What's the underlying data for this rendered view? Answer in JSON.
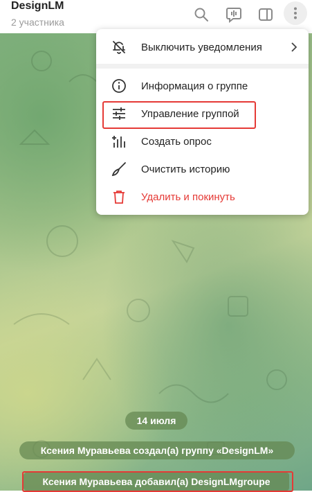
{
  "header": {
    "title": "DesignLM",
    "subtitle": "2 участника",
    "icons": [
      "search-icon",
      "voice-chat-icon",
      "sidebar-toggle-icon",
      "more-vertical-icon"
    ]
  },
  "menu": {
    "items": [
      {
        "label": "Выключить уведомления",
        "icon": "mute-bell-icon"
      },
      {
        "label": "Информация о группе",
        "icon": "info-icon"
      },
      {
        "label": "Управление группой",
        "icon": "sliders-icon"
      },
      {
        "label": "Создать опрос",
        "icon": "poll-icon"
      },
      {
        "label": "Очистить историю",
        "icon": "broom-icon"
      },
      {
        "label": "Удалить и покинуть",
        "icon": "trash-icon"
      }
    ],
    "danger_color": "#e53935"
  },
  "chat": {
    "date": "14 июля",
    "service_messages": [
      "Ксения Муравьева создал(а) группу «DesignLM»",
      "Ксения Муравьева добавил(а) DesignLMgroupe"
    ]
  },
  "colors": {
    "highlight": "#e53935",
    "pill_bg": "#64874f"
  }
}
